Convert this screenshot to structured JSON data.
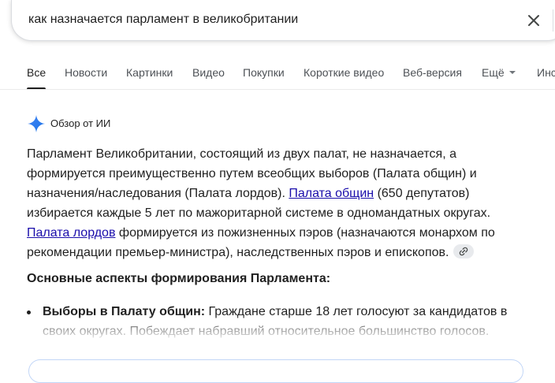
{
  "search": {
    "query": "как назначается парламент в великобритании"
  },
  "tabs": [
    {
      "label": "Все",
      "active": true
    },
    {
      "label": "Новости"
    },
    {
      "label": "Картинки"
    },
    {
      "label": "Видео"
    },
    {
      "label": "Покупки"
    },
    {
      "label": "Короткие видео"
    },
    {
      "label": "Веб-версия"
    },
    {
      "label": "Ещё"
    },
    {
      "label": "Инс"
    }
  ],
  "ai_overview": {
    "title": "Обзор от ИИ",
    "intro": "Парламент Великобритании, состоящий из двух палат, не назначается, а формируется преимущественно путем всеобщих выборов (Палата общин) и назначения/наследования (Палата лордов). ",
    "link1": "Палата общин",
    "after_link1": " (650 депутатов) избирается каждые 5 лет по мажоритарной системе в одномандатных округах. ",
    "link2": "Палата лордов",
    "after_link2": " формируется из пожизненных пэров (назначаются монархом по рекомендации премьер-министра), наследственных пэров и епископов.",
    "section_heading": "Основные аспекты формирования Парламента:",
    "bullet1_bold": "Выборы в Палату общин:",
    "bullet1_text": " Граждане старше 18 лет голосуют за кандидатов в своих округах. Побеждает набравший относительное большинство голосов."
  },
  "colors": {
    "link": "#1a0dab",
    "text": "#1f1f1f",
    "muted": "#4d5156",
    "gemini_blue": "#4285f4"
  },
  "icons": [
    "close-icon",
    "sparkle-icon",
    "link-icon",
    "chevron-down-icon"
  ]
}
